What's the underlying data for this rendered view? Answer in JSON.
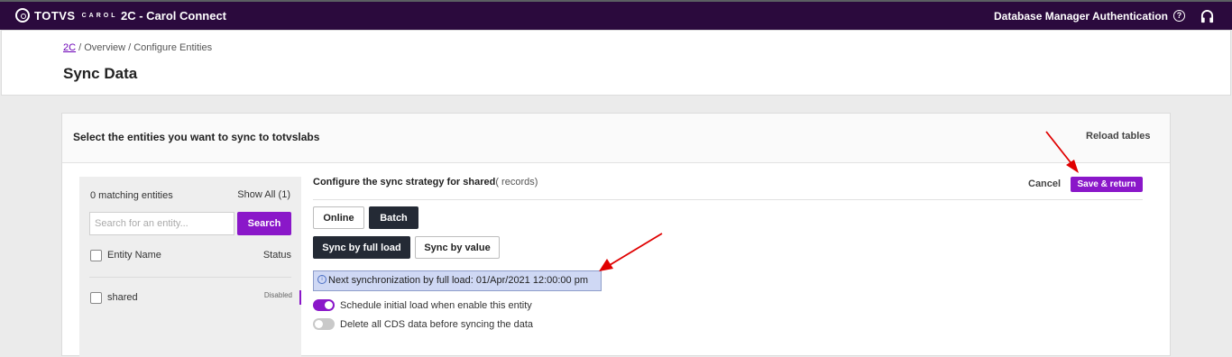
{
  "topbar": {
    "logo_text": "TOTVS",
    "logo_sub": "CAROL",
    "app_title": "2C - Carol Connect",
    "nav": [
      "Database Manager",
      "Authentication"
    ],
    "help_glyph": "?",
    "icons": [
      "help-icon",
      "headset-icon"
    ],
    "color": "#2b0a3d"
  },
  "header": {
    "breadcrumb": {
      "link": "2C",
      "rest": " / Overview / Configure Entities"
    },
    "title": "Sync Data"
  },
  "card": {
    "title": "Select the entities you want to sync to totvslabs",
    "reload": "Reload tables"
  },
  "sidebar": {
    "match_text": "0 matching entities",
    "show_all": "Show All (1)",
    "search": {
      "placeholder": "Search for an entity...",
      "button": "Search"
    },
    "columns": {
      "name": "Entity Name",
      "status": "Status"
    },
    "rows": [
      {
        "name": "shared",
        "status": "Disabled"
      }
    ]
  },
  "config": {
    "title_bold": "Configure the sync strategy for shared",
    "title_muted": "( records)",
    "cancel": "Cancel",
    "save": "Save & return",
    "mode_buttons": [
      "Online",
      "Batch"
    ],
    "active_mode": "Batch",
    "sync_buttons": [
      "Sync by full load",
      "Sync by value"
    ],
    "active_sync": "Sync by full load",
    "info_glyph": "i",
    "info": "Next synchronization by full load: 01/Apr/2021 12:00:00 pm",
    "toggles": [
      {
        "label": "Schedule initial load when enable this entity",
        "on": true
      },
      {
        "label": "Delete all CDS data before syncing the data",
        "on": false
      }
    ]
  },
  "colors": {
    "accent": "#8a17c9",
    "dark_button": "#242a35",
    "info_bg": "#cfd8f4",
    "annotation_arrow": "#e00000"
  }
}
